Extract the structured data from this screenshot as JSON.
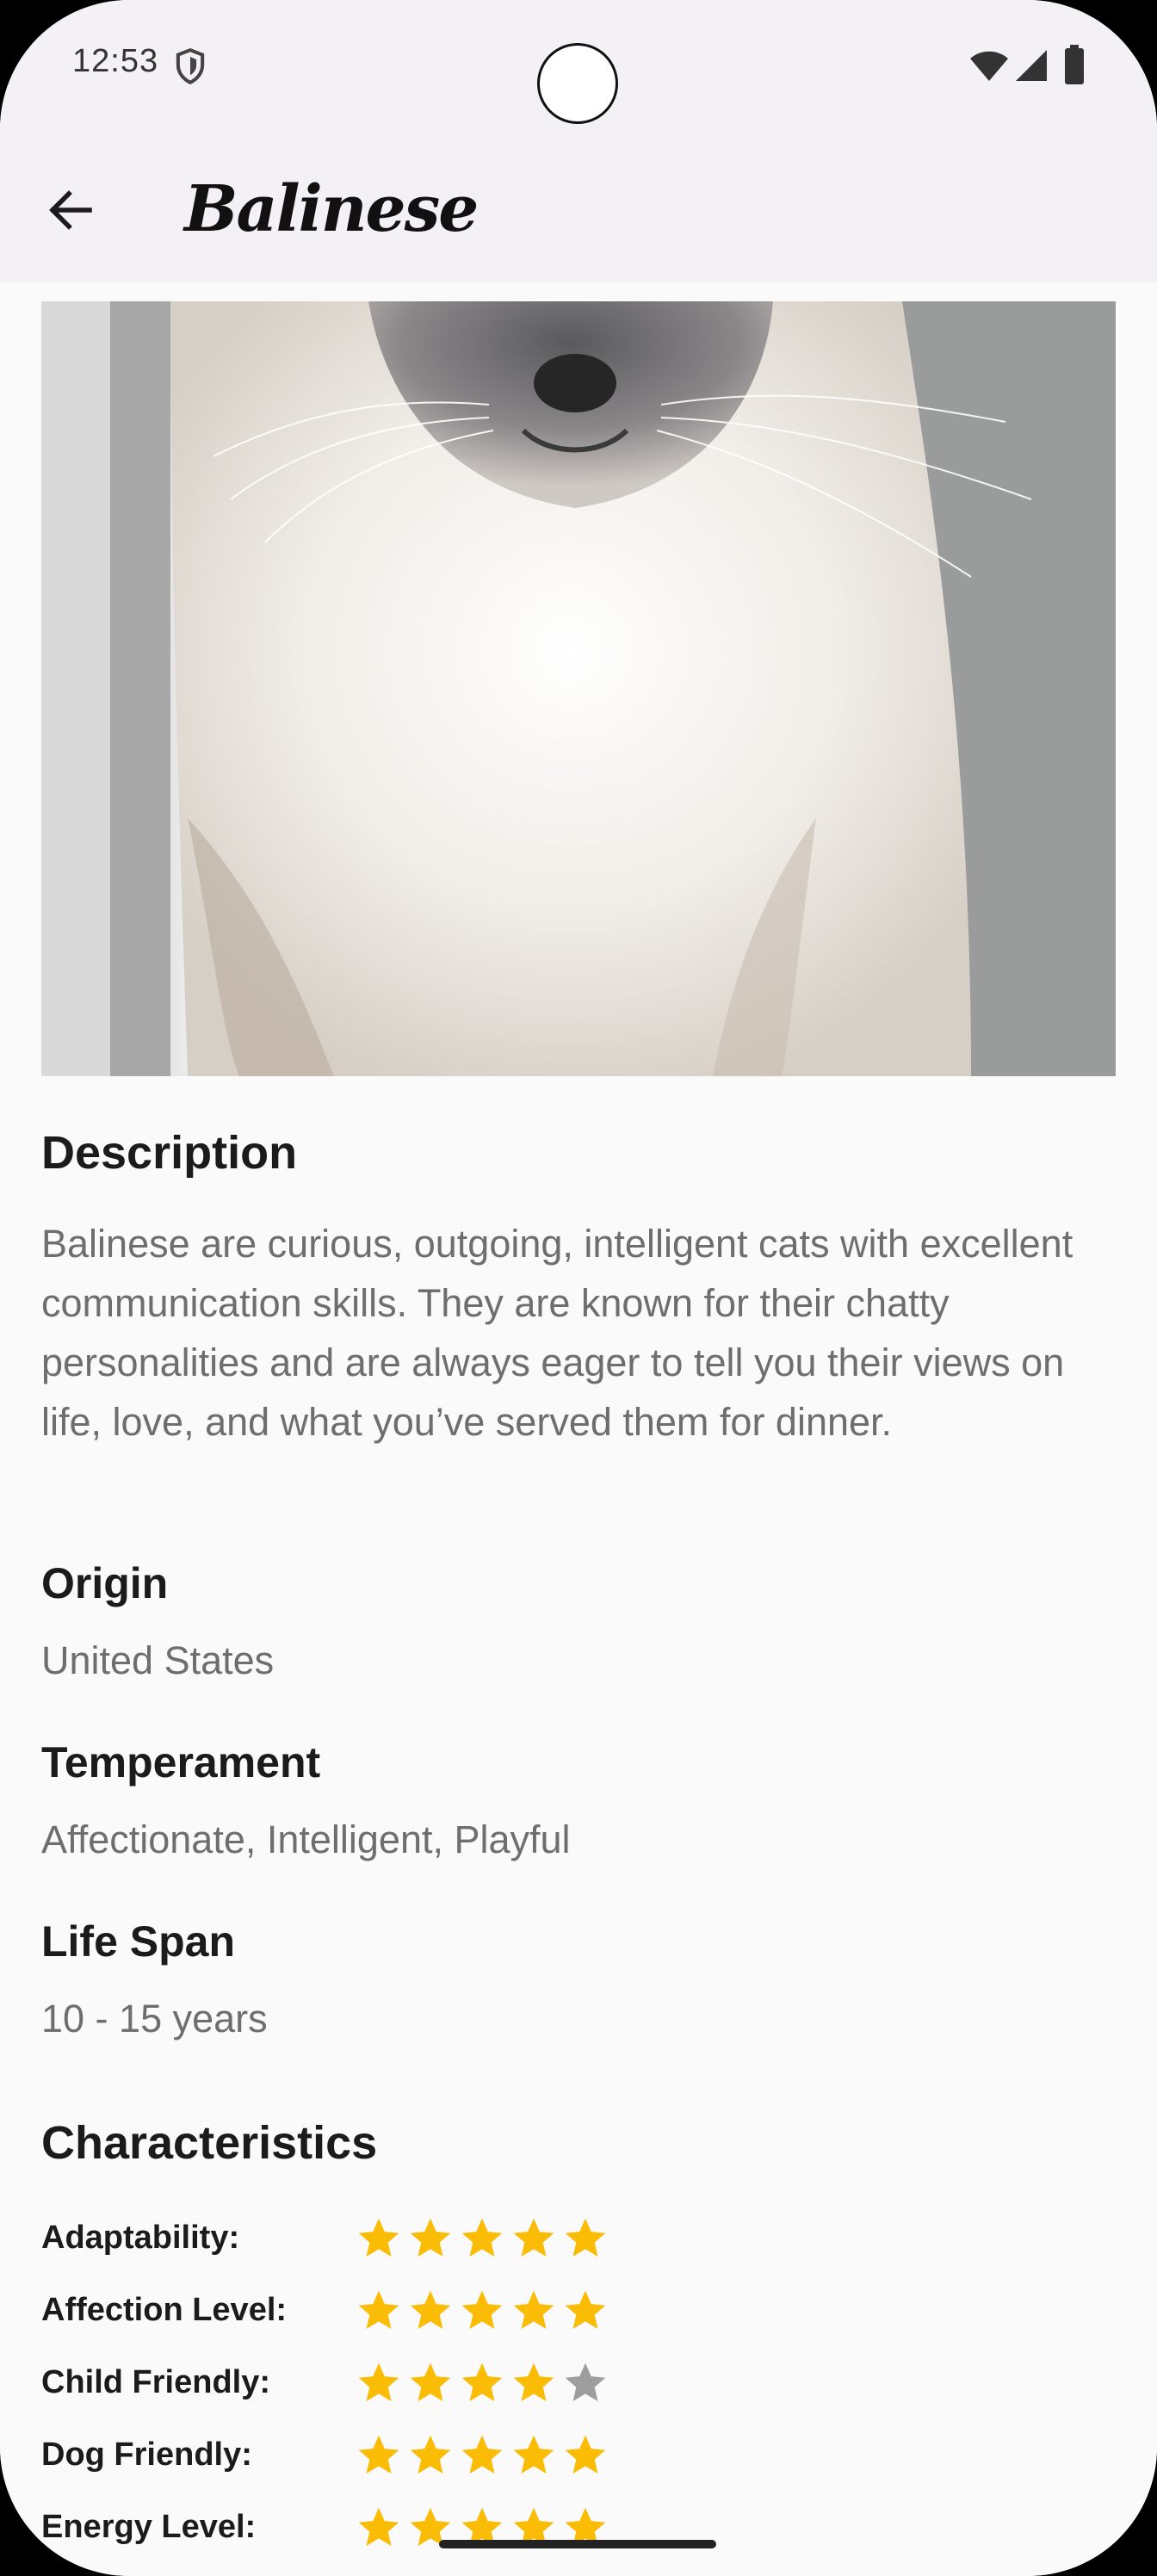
{
  "status_bar": {
    "time": "12:53",
    "icons": [
      "shield-icon",
      "wifi-icon",
      "signal-icon",
      "battery-icon"
    ]
  },
  "app_bar": {
    "back_icon": "arrow-left-icon",
    "title": "Balinese"
  },
  "hero_image": {
    "subject": "cat-photo"
  },
  "description": {
    "heading": "Description",
    "text": "Balinese are curious, outgoing, intelligent cats with excellent communication skills. They are known for their chatty personalities and are always eager to tell you their views on life, love, and what you’ve served them for dinner."
  },
  "origin": {
    "heading": "Origin",
    "value": "United States"
  },
  "temperament": {
    "heading": "Temperament",
    "value": "Affectionate, Intelligent, Playful"
  },
  "life_span": {
    "heading": "Life Span",
    "value": "10 - 15 years"
  },
  "characteristics": {
    "heading": "Characteristics",
    "max_rating": 5,
    "items": [
      {
        "label": "Adaptability:",
        "rating": 5
      },
      {
        "label": "Affection Level:",
        "rating": 5
      },
      {
        "label": "Child Friendly:",
        "rating": 4
      },
      {
        "label": "Dog Friendly:",
        "rating": 5
      },
      {
        "label": "Energy Level:",
        "rating": 5
      }
    ]
  },
  "colors": {
    "star_filled": "#fbbc05",
    "star_empty": "#9e9e9e",
    "app_bar_bg": "#f3f1f6",
    "page_bg": "#fafafa"
  }
}
